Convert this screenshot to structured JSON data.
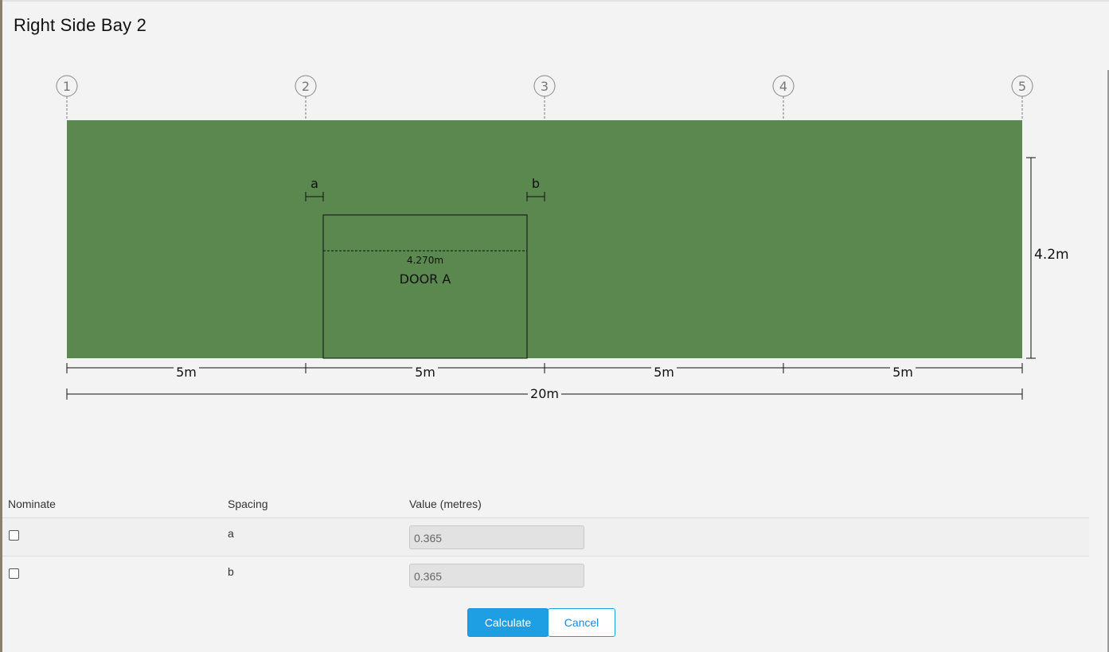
{
  "dialog": {
    "title": "Right Side Bay 2"
  },
  "drawing": {
    "wall_color": "#5a884e",
    "grid_labels": [
      "1",
      "2",
      "3",
      "4",
      "5"
    ],
    "door": {
      "name": "DOOR A",
      "height_label": "4.270m",
      "gap_left_label": "a",
      "gap_right_label": "b"
    },
    "wall_height_label": "4.2m",
    "bay_width_labels": [
      "5m",
      "5m",
      "5m",
      "5m"
    ],
    "total_width_label": "20m"
  },
  "table": {
    "headers": {
      "nominate": "Nominate",
      "spacing": "Spacing",
      "value": "Value (metres)"
    },
    "rows": [
      {
        "spacing": "a",
        "value": "0.365",
        "nominated": false
      },
      {
        "spacing": "b",
        "value": "0.365",
        "nominated": false
      }
    ]
  },
  "buttons": {
    "calculate": "Calculate",
    "cancel": "Cancel"
  }
}
